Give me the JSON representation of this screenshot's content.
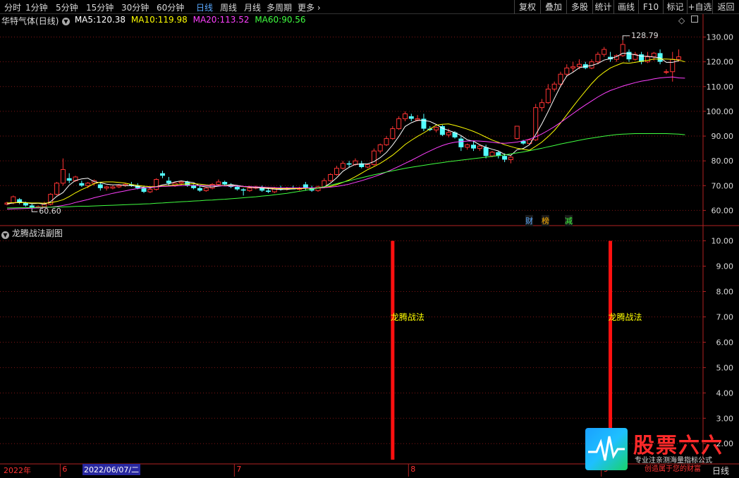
{
  "toolbar": {
    "periods": [
      "分时",
      "1分钟",
      "5分钟",
      "15分钟",
      "30分钟",
      "60分钟",
      "日线",
      "周线",
      "月线",
      "多周期",
      "更多"
    ],
    "active_period": "日线",
    "buttons": [
      "复权",
      "叠加",
      "多股",
      "统计",
      "画线",
      "F10",
      "标记",
      "+自选",
      "返回"
    ]
  },
  "stock": {
    "name": "华特气体",
    "cycle": "(日线)"
  },
  "ma": [
    {
      "label": "MA5:",
      "value": "120.38",
      "color": "#ffffff"
    },
    {
      "label": "MA10:",
      "value": "119.98",
      "color": "#ffff00"
    },
    {
      "label": "MA20:",
      "value": "113.52",
      "color": "#ff40ff"
    },
    {
      "label": "MA60:",
      "value": "90.56",
      "color": "#40ff40"
    }
  ],
  "colors": {
    "up": "#ff3333",
    "down": "#54ffff",
    "grid": "#7f1414",
    "frame": "#b22222",
    "axis_text": "#dcdcdc"
  },
  "price_axis": {
    "min": 55,
    "max": 133,
    "ticks": [
      60,
      70,
      80,
      90,
      100,
      110,
      120,
      130
    ]
  },
  "annotations": {
    "high": "128.79",
    "low": "60.60"
  },
  "event_labels": [
    {
      "text": "财",
      "color": "#5aa9ff"
    },
    {
      "text": "榜",
      "color": "#ffb000"
    },
    {
      "text": "减",
      "color": "#40ff40"
    }
  ],
  "sub_chart": {
    "title": "龙腾战法副图",
    "axis": {
      "min": 1.2,
      "max": 10.6,
      "ticks": [
        10,
        9,
        8,
        7,
        6,
        5,
        4,
        3,
        2
      ]
    },
    "signals": [
      {
        "bar": 62,
        "value": 10,
        "label": "龙腾战法"
      },
      {
        "bar": 97,
        "value": 10,
        "label": "龙腾战法"
      }
    ]
  },
  "time_axis": {
    "year": "2022年",
    "cursor_date": "2022/06/07/二",
    "months": [
      {
        "bar": 9,
        "label": "6"
      },
      {
        "bar": 37,
        "label": "7"
      },
      {
        "bar": 65,
        "label": "8"
      },
      {
        "bar": 96,
        "label": "9"
      }
    ],
    "right_label": "日线"
  },
  "logo": {
    "name": "股票六六",
    "tagline1": "专业注亲测海量指标公式",
    "tagline2": "创造属于您的财富"
  },
  "chart_data": {
    "type": "candlestick",
    "ohlc": [
      [
        62.5,
        63.5,
        62,
        63
      ],
      [
        63,
        66,
        62.5,
        65.5
      ],
      [
        64.5,
        65,
        62.5,
        63
      ],
      [
        63,
        63.5,
        61.5,
        62
      ],
      [
        62,
        62.5,
        60.6,
        61
      ],
      [
        61,
        62,
        60.8,
        61.5
      ],
      [
        61.5,
        63.5,
        61,
        62.5
      ],
      [
        62.5,
        67,
        62,
        66.5
      ],
      [
        66.5,
        71.5,
        66,
        71
      ],
      [
        71,
        81,
        70,
        76.5
      ],
      [
        73,
        75,
        71,
        72
      ],
      [
        72,
        74,
        71.5,
        73.5
      ],
      [
        71,
        72,
        69.5,
        70
      ],
      [
        70,
        71.5,
        69,
        71
      ],
      [
        71,
        72.5,
        70,
        72
      ],
      [
        70.5,
        71.5,
        68,
        69
      ],
      [
        69,
        70,
        68,
        69.5
      ],
      [
        69,
        70,
        68.5,
        69.5
      ],
      [
        69.5,
        70.5,
        69,
        70
      ],
      [
        70,
        71,
        69.5,
        70.5
      ],
      [
        70.5,
        71.5,
        69.5,
        70
      ],
      [
        70,
        71,
        68.5,
        69
      ],
      [
        69,
        70,
        67,
        67.5
      ],
      [
        67.5,
        69,
        67,
        68.5
      ],
      [
        68.5,
        73,
        68,
        72.5
      ],
      [
        75,
        76,
        73,
        74
      ],
      [
        72,
        73.5,
        70,
        71
      ],
      [
        70,
        71.5,
        69.5,
        71
      ],
      [
        71,
        72,
        70,
        71.5
      ],
      [
        71.5,
        72,
        69.5,
        70
      ],
      [
        70,
        70.5,
        68.5,
        69
      ],
      [
        69,
        70,
        67.5,
        68
      ],
      [
        68,
        69.5,
        67.5,
        69
      ],
      [
        69,
        71,
        68.5,
        70.5
      ],
      [
        70.5,
        72.5,
        70,
        71.5
      ],
      [
        71.5,
        72,
        70,
        70.5
      ],
      [
        70.5,
        71,
        69,
        69.5
      ],
      [
        69.5,
        70,
        68,
        68.5
      ],
      [
        68.5,
        69,
        66,
        68
      ],
      [
        68,
        70,
        67.5,
        69
      ],
      [
        69,
        70,
        68.5,
        69.5
      ],
      [
        69.5,
        70,
        67.5,
        68
      ],
      [
        68,
        69,
        67,
        67.5
      ],
      [
        67.5,
        69.5,
        67,
        69
      ],
      [
        69,
        70,
        68,
        68.5
      ],
      [
        68.5,
        69.5,
        68,
        69
      ],
      [
        69,
        70,
        68.5,
        68.5
      ],
      [
        68.5,
        69.5,
        68,
        69
      ],
      [
        70.5,
        71.5,
        68,
        69
      ],
      [
        69,
        70,
        67.5,
        68
      ],
      [
        68,
        70,
        67.5,
        69.5
      ],
      [
        69.5,
        73,
        69,
        72
      ],
      [
        72,
        75,
        71.5,
        74.5
      ],
      [
        74.5,
        78,
        74,
        77
      ],
      [
        77,
        80,
        76.5,
        79
      ],
      [
        79,
        80,
        77.5,
        78.5
      ],
      [
        78.5,
        81,
        78,
        80
      ],
      [
        79,
        80,
        77,
        77.5
      ],
      [
        77.5,
        79,
        77,
        78.5
      ],
      [
        78.5,
        85,
        78,
        84
      ],
      [
        84,
        87,
        83,
        86.5
      ],
      [
        86.5,
        90,
        86,
        89
      ],
      [
        89,
        94,
        88.5,
        93
      ],
      [
        93,
        98,
        92.5,
        97
      ],
      [
        97,
        100,
        96,
        99
      ],
      [
        98,
        99,
        96,
        97
      ],
      [
        96.5,
        98.5,
        96,
        97
      ],
      [
        97,
        99,
        92,
        93
      ],
      [
        93,
        94,
        92,
        92.5
      ],
      [
        92.5,
        94,
        91.5,
        93.5
      ],
      [
        94,
        94.5,
        90,
        90.5
      ],
      [
        90.5,
        93,
        89.5,
        91.5
      ],
      [
        91.5,
        92,
        89,
        89.5
      ],
      [
        89,
        90,
        84,
        85.5
      ],
      [
        85.5,
        87,
        84.5,
        86.5
      ],
      [
        86.5,
        88,
        84,
        85
      ],
      [
        85,
        86.5,
        84,
        86
      ],
      [
        85.5,
        86.5,
        81,
        82
      ],
      [
        82,
        84,
        81.5,
        83.5
      ],
      [
        83.5,
        84,
        81,
        82
      ],
      [
        82,
        83,
        79.5,
        80.5
      ],
      [
        80.5,
        82,
        79,
        81.5
      ],
      [
        89,
        94,
        88.5,
        94
      ],
      [
        88,
        88.5,
        86.5,
        87
      ],
      [
        87,
        89,
        86.5,
        88.5
      ],
      [
        88.5,
        103,
        88,
        101.5
      ],
      [
        101.5,
        105,
        100,
        103.5
      ],
      [
        103.5,
        111,
        103,
        109
      ],
      [
        109,
        112,
        108,
        111
      ],
      [
        111,
        116,
        110,
        115
      ],
      [
        115,
        119,
        114,
        117.5
      ],
      [
        117.5,
        120,
        116,
        118
      ],
      [
        118,
        121,
        117,
        119
      ],
      [
        119,
        120,
        117,
        117.5
      ],
      [
        117.5,
        121,
        117,
        120
      ],
      [
        120,
        124,
        119,
        123
      ],
      [
        123,
        126,
        122,
        125
      ],
      [
        122,
        124,
        120,
        121
      ],
      [
        121,
        123,
        120,
        122.5
      ],
      [
        122.5,
        128.79,
        122,
        127
      ],
      [
        124,
        125,
        120,
        121
      ],
      [
        121,
        124,
        120.5,
        123
      ],
      [
        123,
        124,
        119,
        120
      ],
      [
        120,
        124,
        119.5,
        122
      ],
      [
        122,
        124,
        120.5,
        123.5
      ],
      [
        123.5,
        125,
        119,
        120
      ],
      [
        116,
        117,
        115,
        116
      ],
      [
        116,
        124,
        112,
        121
      ],
      [
        121,
        125,
        120,
        122
      ]
    ],
    "ma5": [
      62.6,
      63,
      63.4,
      63.2,
      62.7,
      62.9,
      62.5,
      63.5,
      65.7,
      67.2,
      70.2,
      72.1,
      72.7,
      73.0,
      71.6,
      71.2,
      70.6,
      70.3,
      70.4,
      70.0,
      70.0,
      69.7,
      69.3,
      69.1,
      69.6,
      70.3,
      70.7,
      71.5,
      71.9,
      71.6,
      71.2,
      69.9,
      69.5,
      69.5,
      69.8,
      70.0,
      70.4,
      70.1,
      69.7,
      69.3,
      69.2,
      69.0,
      68.8,
      68.6,
      68.4,
      68.5,
      68.7,
      68.8,
      69.0,
      69.1,
      69.0,
      69.5,
      71.0,
      73.2,
      75.8,
      77.4,
      78.6,
      78.7,
      78.8,
      79.7,
      81.3,
      83.4,
      86.4,
      89.9,
      93.9,
      95.4,
      96.4,
      96.3,
      95.9,
      94.7,
      93.2,
      92.3,
      91.4,
      90.2,
      88.5,
      87.9,
      86.5,
      85.5,
      84.7,
      84.0,
      82.6,
      82.2,
      84.5,
      85.0,
      86.5,
      90.6,
      95.0,
      99.9,
      105.2,
      110.2,
      114.3,
      115.8,
      117.6,
      118.1,
      118.5,
      119.3,
      120.7,
      121.3,
      122.1,
      123.5,
      123.3,
      122.8,
      122.3,
      122.2,
      121.9,
      121.6,
      119.8,
      119.8,
      120.4
    ],
    "ma10": [
      63,
      63.1,
      63.2,
      63.1,
      63,
      63,
      62.9,
      63.1,
      63.6,
      64.3,
      65.6,
      67.1,
      68.4,
      69.5,
      70.8,
      71.4,
      71.5,
      71.5,
      71.3,
      71.0,
      70.5,
      70.1,
      69.8,
      69.6,
      69.6,
      69.9,
      70.0,
      70.3,
      70.5,
      70.7,
      70.8,
      70.6,
      70.3,
      70.1,
      70.1,
      70.0,
      70.0,
      69.8,
      69.6,
      69.5,
      69.4,
      69.3,
      69.1,
      68.9,
      68.8,
      68.8,
      68.8,
      68.8,
      68.9,
      69.0,
      69.0,
      69.2,
      69.7,
      70.4,
      71.3,
      72.3,
      73.6,
      75.0,
      76.5,
      77.7,
      79.0,
      80.6,
      82.3,
      84.4,
      86.6,
      88.3,
      89.9,
      91.3,
      92.9,
      94.4,
      94.8,
      94.9,
      94.3,
      93.6,
      92.8,
      91.9,
      90.8,
      89.6,
      88.4,
      87.5,
      86.5,
      85.8,
      85.1,
      84.7,
      84.3,
      85.9,
      87.6,
      89.8,
      92.3,
      95.3,
      98.6,
      101.9,
      105.1,
      108.2,
      111.2,
      113.8,
      115.8,
      117.5,
      118.6,
      119.6,
      119.4,
      119.8,
      120.2,
      120.6,
      121.1,
      121.1,
      121.1,
      121.0,
      120.7,
      120.0
    ],
    "ma20": [
      60.5,
      60.6,
      60.7,
      60.8,
      60.9,
      61,
      61.1,
      61.3,
      61.6,
      62,
      62.5,
      63.2,
      63.8,
      64.4,
      65.1,
      65.7,
      66.3,
      66.9,
      67.4,
      67.9,
      68.4,
      68.8,
      69.1,
      69.3,
      69.5,
      69.7,
      69.8,
      69.9,
      70.0,
      70.1,
      70.1,
      70.1,
      70.0,
      70.0,
      70.0,
      69.9,
      69.9,
      69.8,
      69.7,
      69.6,
      69.5,
      69.4,
      69.3,
      69.2,
      69.1,
      69.1,
      69.1,
      69.1,
      69.1,
      69.1,
      69.1,
      69.2,
      69.4,
      69.7,
      70.1,
      70.6,
      71.3,
      72.0,
      72.8,
      73.6,
      74.5,
      75.5,
      76.6,
      77.8,
      79.0,
      80.2,
      81.5,
      82.8,
      84.0,
      85.2,
      86.2,
      87.0,
      87.5,
      87.8,
      88.0,
      88.1,
      88.0,
      87.8,
      87.5,
      87.2,
      87.1,
      87.3,
      87.6,
      88.1,
      88.8,
      89.7,
      90.9,
      92.3,
      93.8,
      95.5,
      97.3,
      99.1,
      100.9,
      102.6,
      104.2,
      105.8,
      107.2,
      108.4,
      109.3,
      110.2,
      110.9,
      111.6,
      112.2,
      112.6,
      113.1,
      113.5,
      113.7,
      113.9,
      113.5,
      113.4
    ],
    "ma60": [
      61,
      61,
      61.1,
      61.1,
      61.2,
      61.2,
      61.3,
      61.3,
      61.4,
      61.4,
      61.5,
      61.6,
      61.7,
      61.7,
      61.8,
      61.9,
      62.0,
      62.1,
      62.2,
      62.3,
      62.4,
      62.5,
      62.6,
      62.7,
      62.9,
      63.0,
      63.2,
      63.3,
      63.5,
      63.6,
      63.8,
      63.9,
      64.1,
      64.2,
      64.4,
      64.5,
      64.7,
      64.9,
      65.1,
      65.3,
      65.5,
      65.8,
      66.0,
      66.3,
      66.6,
      66.9,
      67.3,
      67.7,
      68.1,
      68.6,
      69.1,
      69.6,
      70.2,
      70.8,
      71.4,
      72.0,
      72.6,
      73.2,
      73.8,
      74.4,
      74.9,
      75.5,
      76.0,
      76.5,
      77.0,
      77.4,
      77.8,
      78.2,
      78.6,
      79.0,
      79.3,
      79.7,
      80.0,
      80.3,
      80.6,
      80.9,
      81.2,
      81.5,
      81.8,
      82.1,
      82.4,
      82.8,
      83.2,
      83.6,
      84.1,
      84.6,
      85.1,
      85.7,
      86.2,
      86.8,
      87.3,
      87.8,
      88.3,
      88.8,
      89.2,
      89.6,
      90.0,
      90.3,
      90.6,
      90.8,
      90.9,
      91.0,
      91.0,
      91.0,
      91.0,
      91.0,
      91.0,
      90.9,
      90.8,
      90.56
    ],
    "ylim": [
      55,
      133
    ]
  }
}
